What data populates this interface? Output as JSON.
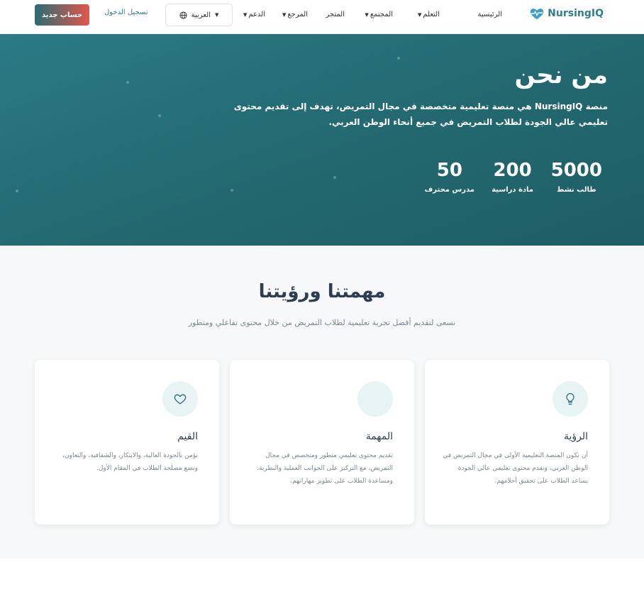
{
  "navbar": {
    "brand": "NursingIQ",
    "links": [
      {
        "label": "الرئيسية",
        "dropdown": false
      },
      {
        "label": "التعلم",
        "dropdown": true
      },
      {
        "label": "المجتمع",
        "dropdown": true
      },
      {
        "label": "المتجر",
        "dropdown": false
      },
      {
        "label": "المرجع",
        "dropdown": true
      },
      {
        "label": "الدعم",
        "dropdown": true
      }
    ],
    "language": "العربية",
    "login": "تسجيل الدخول",
    "signup": "حساب جديد"
  },
  "hero": {
    "title": "من نحن",
    "description": "منصة NursingIQ هي منصة تعليمية متخصصة في مجال التمريض، تهدف إلى تقديم محتوى تعليمي عالي الجودة لطلاب التمريض في جميع أنحاء الوطن العربي.",
    "stats": [
      {
        "number": "5000",
        "label": "طالب نشط"
      },
      {
        "number": "200",
        "label": "مادة دراسية"
      },
      {
        "number": "50",
        "label": "مدرس محترف"
      }
    ]
  },
  "mission": {
    "title": "مهمتنا ورؤيتنا",
    "subtitle": "نسعى لتقديم أفضل تجربة تعليمية لطلاب التمريض من خلال محتوى تفاعلي ومتطور",
    "cards": [
      {
        "icon": "lightbulb-icon",
        "title": "الرؤية",
        "text": "أن نكون المنصة التعليمية الأولى في مجال التمريض في الوطن العربي، ونقدم محتوى تعليمي عالي الجودة يساعد الطلاب على تحقيق أحلامهم."
      },
      {
        "icon": "target-icon",
        "title": "المهمة",
        "text": "تقديم محتوى تعليمي متطور ومتخصص في مجال التمريض، مع التركيز على الجوانب العملية والنظرية، ومساعدة الطلاب على تطوير مهاراتهم."
      },
      {
        "icon": "heart-icon",
        "title": "القيم",
        "text": "نؤمن بالجودة العالية، والابتكار، والشفافية، والتعاون، ونضع مصلحة الطلاب في المقام الأول."
      }
    ]
  },
  "colors": {
    "primary": "#2f7f8c",
    "hero_bg": "#23686f",
    "signup_gradient_start": "#2b6c72",
    "signup_gradient_end": "#e2574c",
    "section_bg": "#f6f8f9"
  }
}
